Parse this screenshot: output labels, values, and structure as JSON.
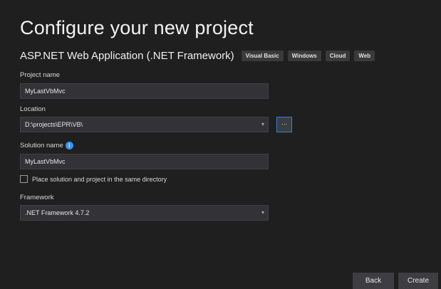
{
  "page": {
    "title": "Configure your new project",
    "template_name": "ASP.NET Web Application (.NET Framework)",
    "tags": [
      "Visual Basic",
      "Windows",
      "Cloud",
      "Web"
    ]
  },
  "form": {
    "project_name": {
      "label": "Project name",
      "value": "MyLastVbMvc"
    },
    "location": {
      "label": "Location",
      "value": "D:\\projects\\EPR\\VB\\",
      "browse_label": "..."
    },
    "solution_name": {
      "label": "Solution name",
      "value": "MyLastVbMvc",
      "info_glyph": "i"
    },
    "same_directory": {
      "label": "Place solution and project in the same directory",
      "checked": false
    },
    "framework": {
      "label": "Framework",
      "value": ".NET Framework 4.7.2"
    }
  },
  "footer": {
    "back_label": "Back",
    "create_label": "Create"
  },
  "colors": {
    "background": "#1f1f1f",
    "field": "#333337",
    "accent": "#3794ff"
  }
}
